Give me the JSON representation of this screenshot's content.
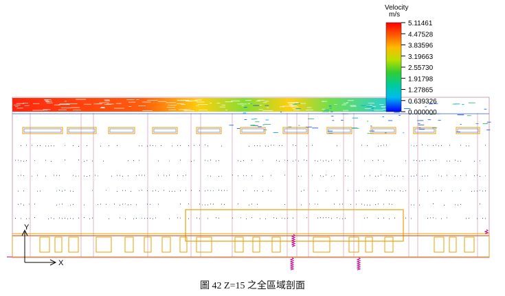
{
  "legend": {
    "title": "Velocity",
    "unit": "m/s",
    "ticks": [
      "5.11461",
      "4.47528",
      "3.83596",
      "3.19663",
      "2.55730",
      "1.91798",
      "1.27865",
      "0.639326",
      "0.000000"
    ],
    "colors": [
      "#ff0000",
      "#ff6a00",
      "#ffcc00",
      "#aaee00",
      "#22cc22",
      "#00cc88",
      "#00ccee",
      "#0066ff",
      "#0000ff"
    ]
  },
  "axes": {
    "y_label": "Y",
    "x_label": "X"
  },
  "caption": "圖 42 Z=15 之全區域剖面",
  "colors": {
    "outline": "#cfa0b6",
    "box": "#e8a000",
    "magenta": "#b0008c",
    "blue_line": "#3355dd",
    "dots": "#334488"
  }
}
